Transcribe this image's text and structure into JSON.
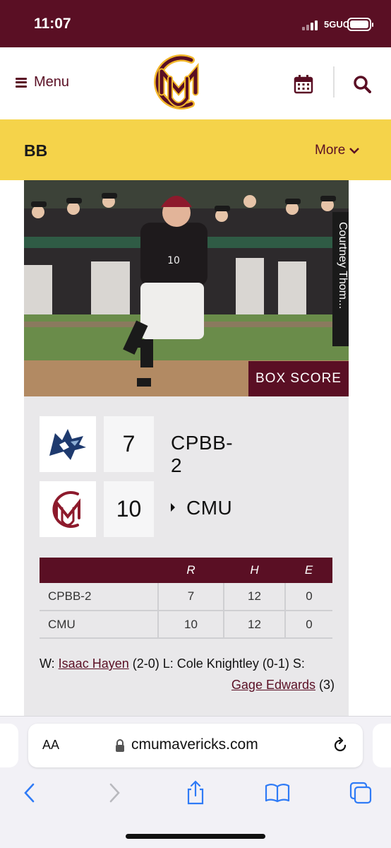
{
  "status_bar": {
    "time": "11:07",
    "network": "5GUC"
  },
  "header": {
    "menu_label": "Menu",
    "logo_monogram": "CMU"
  },
  "section_bar": {
    "title": "BB",
    "more_label": "More"
  },
  "photo": {
    "credit": "Courtney Thom...",
    "box_score_label": "BOX SCORE"
  },
  "game": {
    "teams": [
      {
        "name": "CPBB-2",
        "score": "7",
        "winner": false
      },
      {
        "name": "CMU",
        "score": "10",
        "winner": true
      }
    ],
    "linescore": {
      "headers": [
        "R",
        "H",
        "E"
      ],
      "rows": [
        {
          "team": "CPBB-2",
          "r": "7",
          "h": "12",
          "e": "0"
        },
        {
          "team": "CMU",
          "r": "10",
          "h": "12",
          "e": "0"
        }
      ]
    },
    "decision": {
      "w_label": "W: ",
      "w_player": "Isaac Hayen",
      "w_record": " (2-0) L: Cole Knightley (0-1) S:",
      "s_player": "Gage Edwards",
      "s_record": " (3)"
    }
  },
  "browser": {
    "text_size_label": "AA",
    "url": "cmumavericks.com"
  },
  "colors": {
    "maroon": "#5a0f24",
    "gold": "#f5d34a",
    "card_gray": "#e9e8ea",
    "ios_blue": "#2f7bf6"
  }
}
